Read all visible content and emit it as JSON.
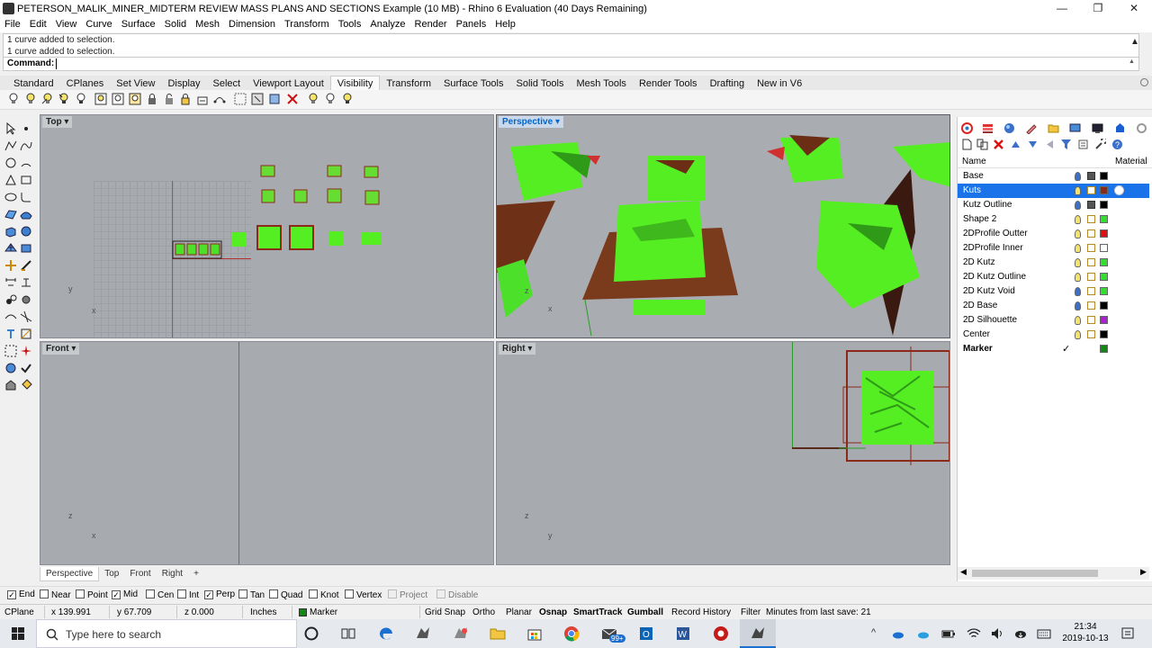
{
  "window": {
    "title": "PETERSON_MALIK_MINER_MIDTERM REVIEW MASS PLANS AND SECTIONS Example (10 MB) - Rhino 6 Evaluation (40 Days Remaining)",
    "minimize_glyph": "—",
    "maximize_glyph": "❐",
    "close_glyph": "✕"
  },
  "menu": [
    "File",
    "Edit",
    "View",
    "Curve",
    "Surface",
    "Solid",
    "Mesh",
    "Dimension",
    "Transform",
    "Tools",
    "Analyze",
    "Render",
    "Panels",
    "Help"
  ],
  "command": {
    "history": [
      "1 curve added to selection.",
      "1 curve added to selection."
    ],
    "prompt": "Command:",
    "value": ""
  },
  "toolbar_tabs": [
    "Standard",
    "CPlanes",
    "Set View",
    "Display",
    "Select",
    "Viewport Layout",
    "Visibility",
    "Transform",
    "Surface Tools",
    "Solid Tools",
    "Mesh Tools",
    "Render Tools",
    "Drafting",
    "New in V6"
  ],
  "active_toolbar_tab": "Visibility",
  "viewports": {
    "top": {
      "label": "Top",
      "axis_y": "y",
      "axis_x": "x"
    },
    "perspective": {
      "label": "Perspective",
      "axis_z": "z",
      "axis_x": "x"
    },
    "front": {
      "label": "Front",
      "axis_z": "z",
      "axis_x": "x"
    },
    "right": {
      "label": "Right",
      "axis_z": "z",
      "axis_y": "y"
    },
    "dropdown_glyph": "▾"
  },
  "viewport_tabs": [
    "Perspective",
    "Top",
    "Front",
    "Right"
  ],
  "viewport_tab_add": "+",
  "layers": {
    "col_name": "Name",
    "col_material": "Material",
    "rows": [
      {
        "name": "Base",
        "color": "#000000"
      },
      {
        "name": "Kuts",
        "color": "#8b2a1a",
        "selected": true
      },
      {
        "name": "Kutz Outline",
        "color": "#000000"
      },
      {
        "name": "Shape 2",
        "color": "#33dd33"
      },
      {
        "name": "2DProfile Outter",
        "color": "#dd1111"
      },
      {
        "name": "2DProfile Inner",
        "color": "#ffffff"
      },
      {
        "name": "2D Kutz",
        "color": "#33dd33"
      },
      {
        "name": "2D Kutz Outline",
        "color": "#33dd33"
      },
      {
        "name": "2D Kutz Void",
        "color": "#33dd33"
      },
      {
        "name": "2D Base",
        "color": "#000000"
      },
      {
        "name": "2D Silhouette",
        "color": "#aa22cc"
      },
      {
        "name": "Center",
        "color": "#000000"
      },
      {
        "name": "Marker",
        "color": "#118811",
        "current": true
      }
    ],
    "current_check": "✓"
  },
  "osnap": [
    {
      "label": "End",
      "checked": true
    },
    {
      "label": "Near",
      "checked": false
    },
    {
      "label": "Point",
      "checked": false
    },
    {
      "label": "Mid",
      "checked": true
    },
    {
      "label": "Cen",
      "checked": false
    },
    {
      "label": "Int",
      "checked": false
    },
    {
      "label": "Perp",
      "checked": true
    },
    {
      "label": "Tan",
      "checked": false
    },
    {
      "label": "Quad",
      "checked": false
    },
    {
      "label": "Knot",
      "checked": false
    },
    {
      "label": "Vertex",
      "checked": false
    },
    {
      "label": "Project",
      "checked": false,
      "disabled": true
    },
    {
      "label": "Disable",
      "checked": false,
      "disabled": true
    }
  ],
  "status": {
    "cplane": "CPlane",
    "x": "x 139.991",
    "y": "y 67.709",
    "z": "z 0.000",
    "units": "Inches",
    "layer": "Marker",
    "layer_color": "#118811",
    "grid_snap": "Grid Snap",
    "ortho": "Ortho",
    "planar": "Planar",
    "osnap": "Osnap",
    "smarttrack": "SmartTrack",
    "gumball": "Gumball",
    "record_history": "Record History",
    "filter": "Filter",
    "save_msg": "Minutes from last save: 21"
  },
  "taskbar": {
    "search_placeholder": "Type here to search",
    "mail_badge": "99+",
    "time": "21:34",
    "date": "2019-10-13"
  }
}
